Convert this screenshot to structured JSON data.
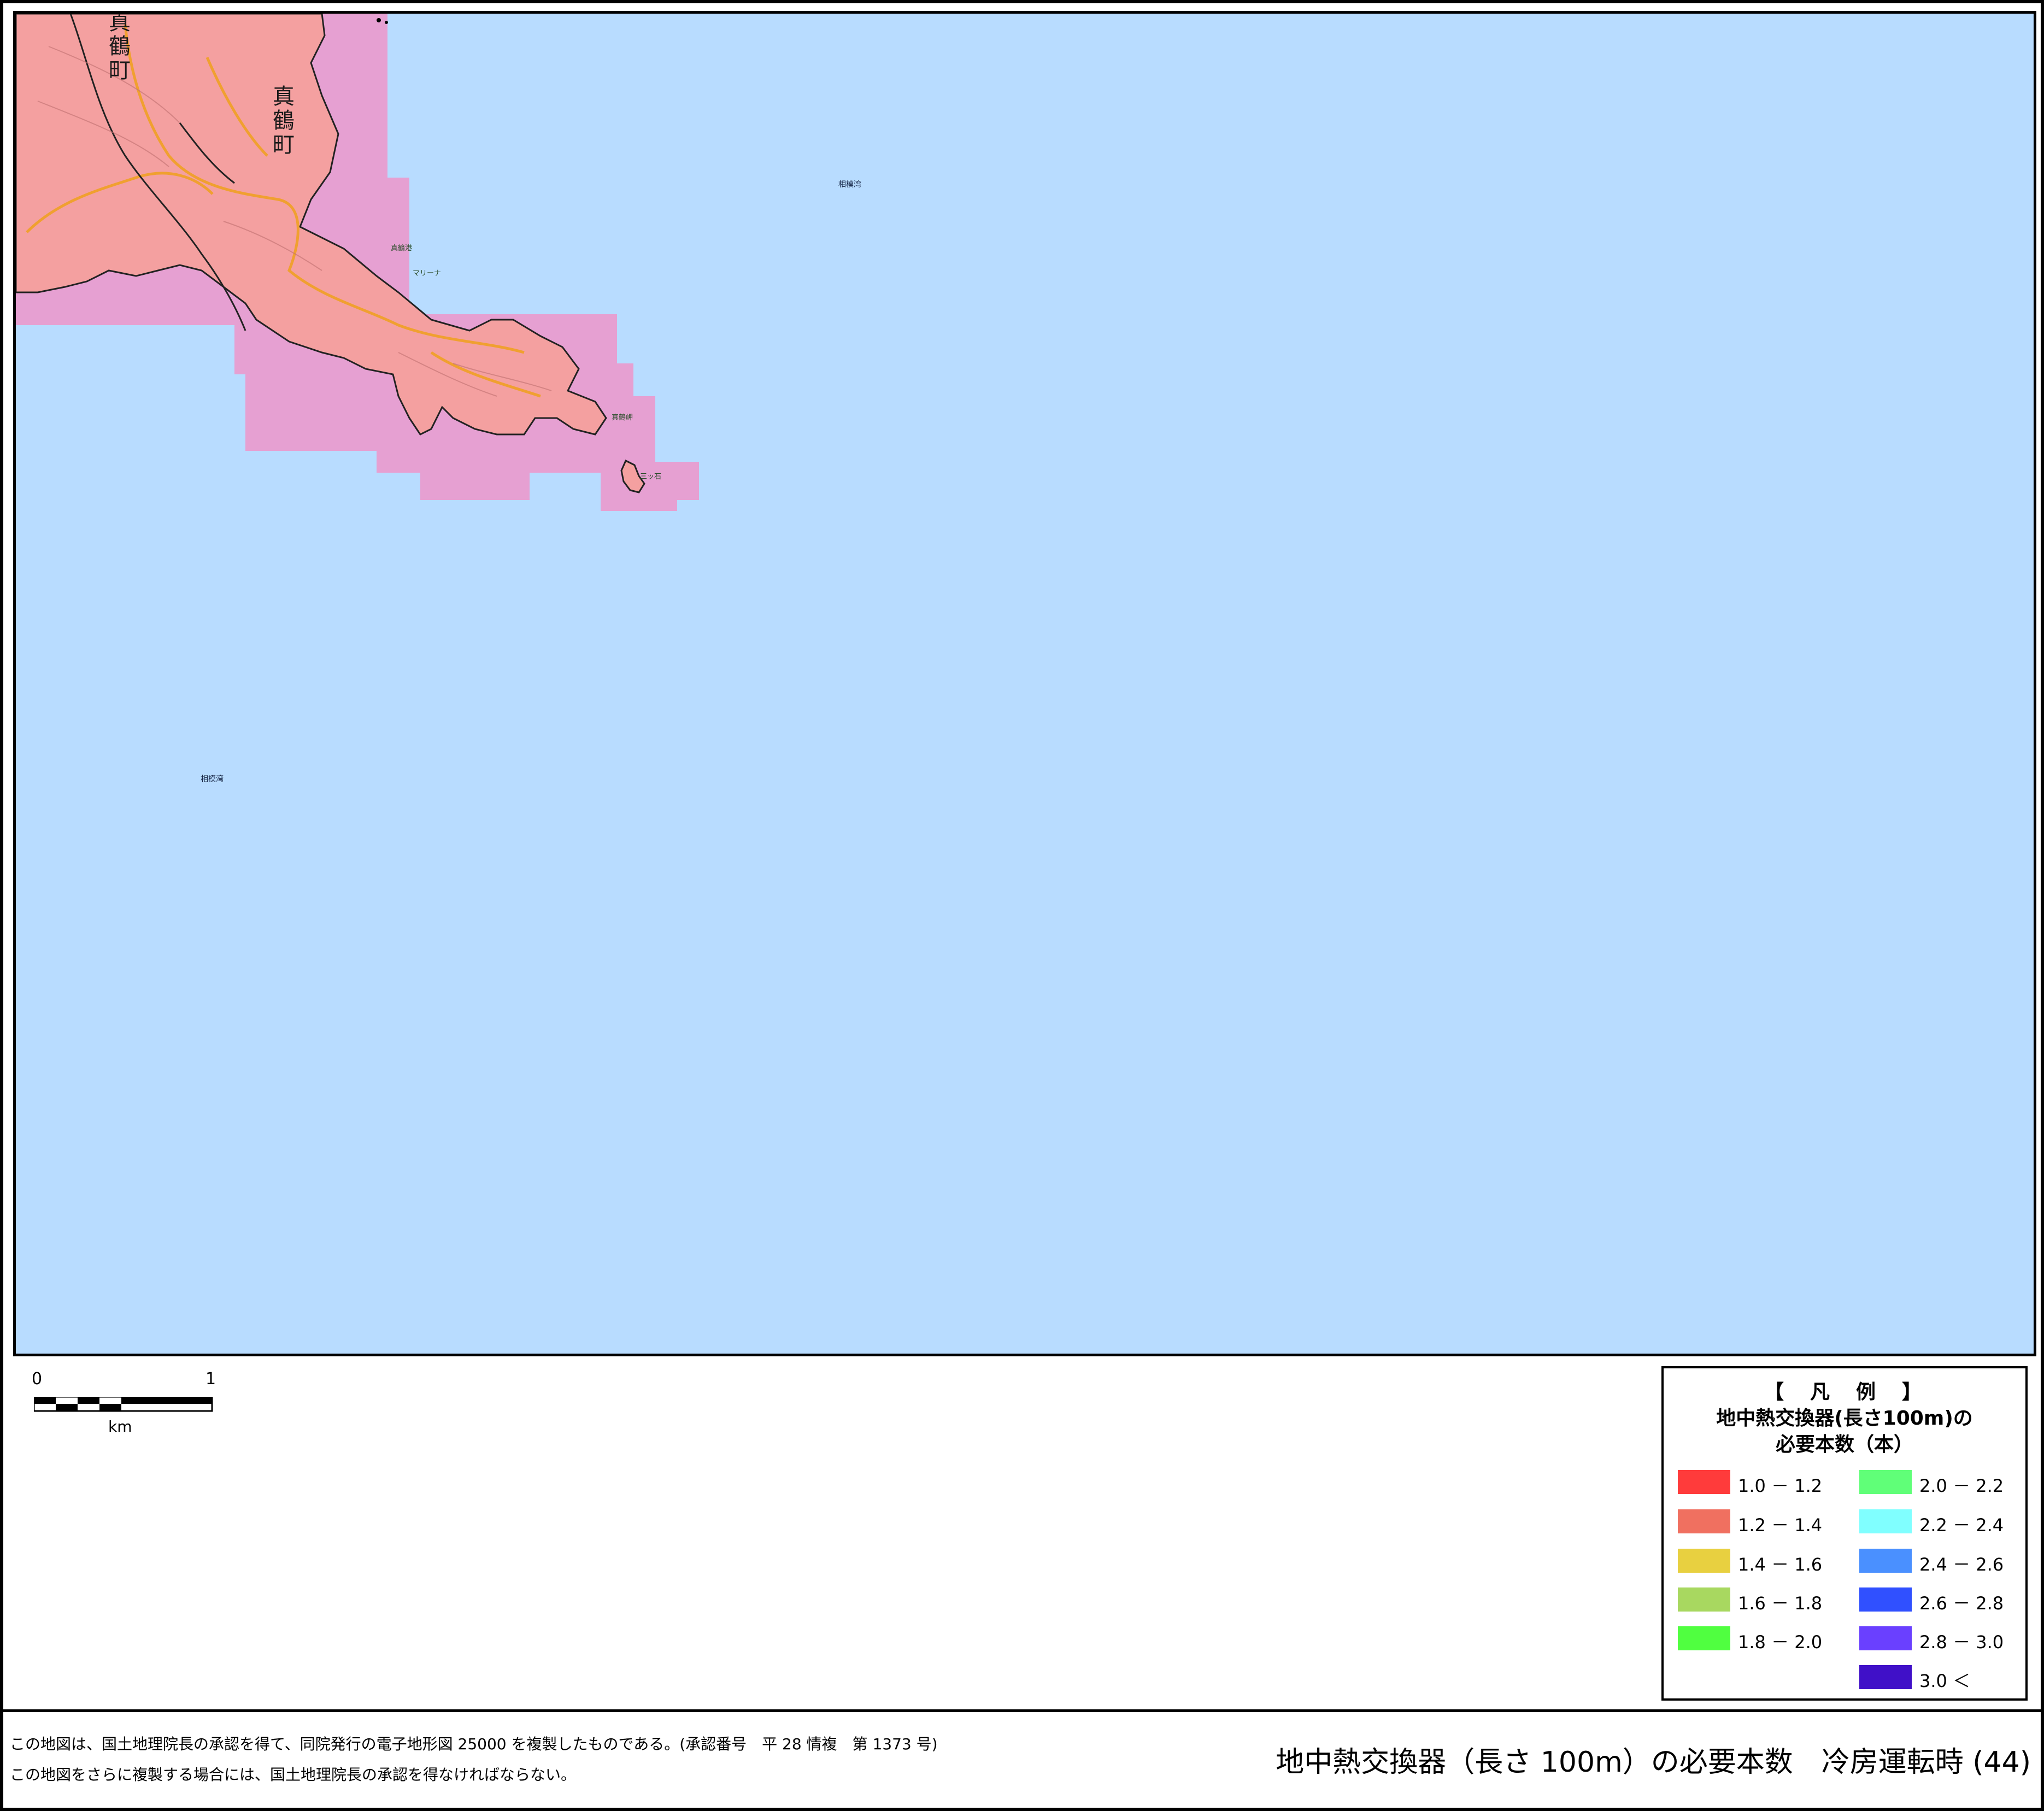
{
  "map": {
    "town_labels": [
      "真鶴町",
      "真鶴町"
    ],
    "place_labels": [
      "相模湾",
      "相模湾",
      "真鶴港",
      "マリーナ",
      "三ッ石",
      "真鶴岬"
    ],
    "sea_color": "#b8dcff",
    "land_color": "#f4a0a0",
    "grid_cell_color": "#e6a0d2",
    "road_color": "#f0a030"
  },
  "scale_bar": {
    "zero": "0",
    "one": "1",
    "unit": "km"
  },
  "legend": {
    "heading": "【　凡　例　】",
    "title_line1": "地中熱交換器(長さ100m)の",
    "title_line2": "必要本数（本）",
    "items": [
      {
        "label": "1.0 － 1.2",
        "color": "#ff3b3b"
      },
      {
        "label": "1.2 － 1.4",
        "color": "#f07060"
      },
      {
        "label": "1.4 － 1.6",
        "color": "#e8d040"
      },
      {
        "label": "1.6 － 1.8",
        "color": "#a8d860"
      },
      {
        "label": "1.8 － 2.0",
        "color": "#50ff40"
      },
      {
        "label": "2.0 － 2.2",
        "color": "#60ff78"
      },
      {
        "label": "2.2 － 2.4",
        "color": "#80ffff"
      },
      {
        "label": "2.4 － 2.6",
        "color": "#4a90ff"
      },
      {
        "label": "2.6 － 2.8",
        "color": "#3050ff"
      },
      {
        "label": "2.8 － 3.0",
        "color": "#6a40ff"
      },
      {
        "label": "3.0 ＜",
        "color": "#4010c8"
      }
    ]
  },
  "footer": {
    "credit_line1": "この地図は、国土地理院長の承認を得て、同院発行の電子地形図 25000 を複製したものである。(承認番号　平 28 情複　第 1373 号)",
    "credit_line2": "この地図をさらに複製する場合には、国土地理院長の承認を得なければならない。",
    "sheet_title": "地中熱交換器（長さ 100m）の必要本数　冷房運転時 (44)"
  }
}
